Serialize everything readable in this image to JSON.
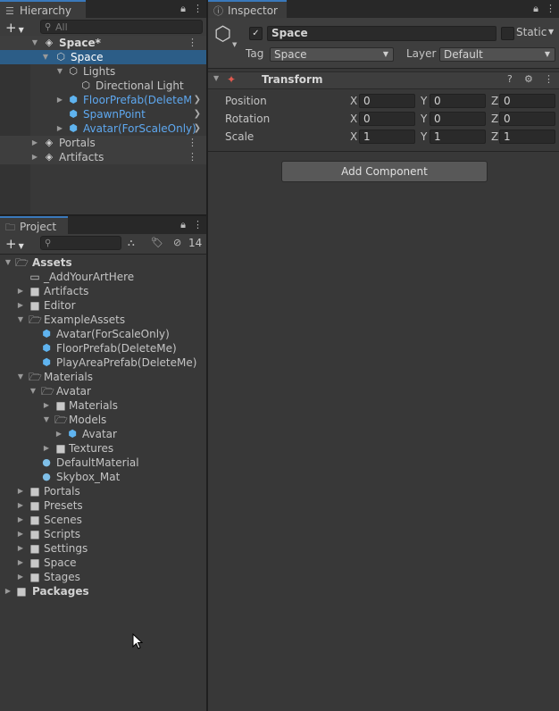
{
  "hierarchy": {
    "tab_label": "Hierarchy",
    "search_placeholder": "All",
    "items": [
      {
        "label": "Space*"
      },
      {
        "label": "Space"
      },
      {
        "label": "Lights"
      },
      {
        "label": "Directional Light"
      },
      {
        "label": "FloorPrefab(DeleteMe"
      },
      {
        "label": "SpawnPoint"
      },
      {
        "label": "Avatar(ForScaleOnly)"
      },
      {
        "label": "Portals"
      },
      {
        "label": "Artifacts"
      }
    ]
  },
  "project": {
    "tab_label": "Project",
    "hidden_count": "14",
    "items": [
      {
        "label": "Assets"
      },
      {
        "label": "_AddYourArtHere"
      },
      {
        "label": "Artifacts"
      },
      {
        "label": "Editor"
      },
      {
        "label": "ExampleAssets"
      },
      {
        "label": "Avatar(ForScaleOnly)"
      },
      {
        "label": "FloorPrefab(DeleteMe)"
      },
      {
        "label": "PlayAreaPrefab(DeleteMe)"
      },
      {
        "label": "Materials"
      },
      {
        "label": "Avatar"
      },
      {
        "label": "Materials"
      },
      {
        "label": "Models"
      },
      {
        "label": "Avatar"
      },
      {
        "label": "Textures"
      },
      {
        "label": "DefaultMaterial"
      },
      {
        "label": "Skybox_Mat"
      },
      {
        "label": "Portals"
      },
      {
        "label": "Presets"
      },
      {
        "label": "Scenes"
      },
      {
        "label": "Scripts"
      },
      {
        "label": "Settings"
      },
      {
        "label": "Space"
      },
      {
        "label": "Stages"
      },
      {
        "label": "Packages"
      }
    ]
  },
  "inspector": {
    "tab_label": "Inspector",
    "object_name": "Space",
    "static_label": "Static",
    "tag_label": "Tag",
    "tag_value": "Space",
    "layer_label": "Layer",
    "layer_value": "Default",
    "component_title": "Transform",
    "rows": [
      {
        "label": "Position",
        "x": "0",
        "y": "0",
        "z": "0"
      },
      {
        "label": "Rotation",
        "x": "0",
        "y": "0",
        "z": "0"
      },
      {
        "label": "Scale",
        "x": "1",
        "y": "1",
        "z": "1"
      }
    ],
    "axis_labels": {
      "x": "X",
      "y": "Y",
      "z": "Z"
    },
    "add_component_label": "Add Component"
  },
  "colors": {
    "selection": "#2c5d87",
    "prefab_text": "#5ea8f0",
    "background": "#383838"
  }
}
